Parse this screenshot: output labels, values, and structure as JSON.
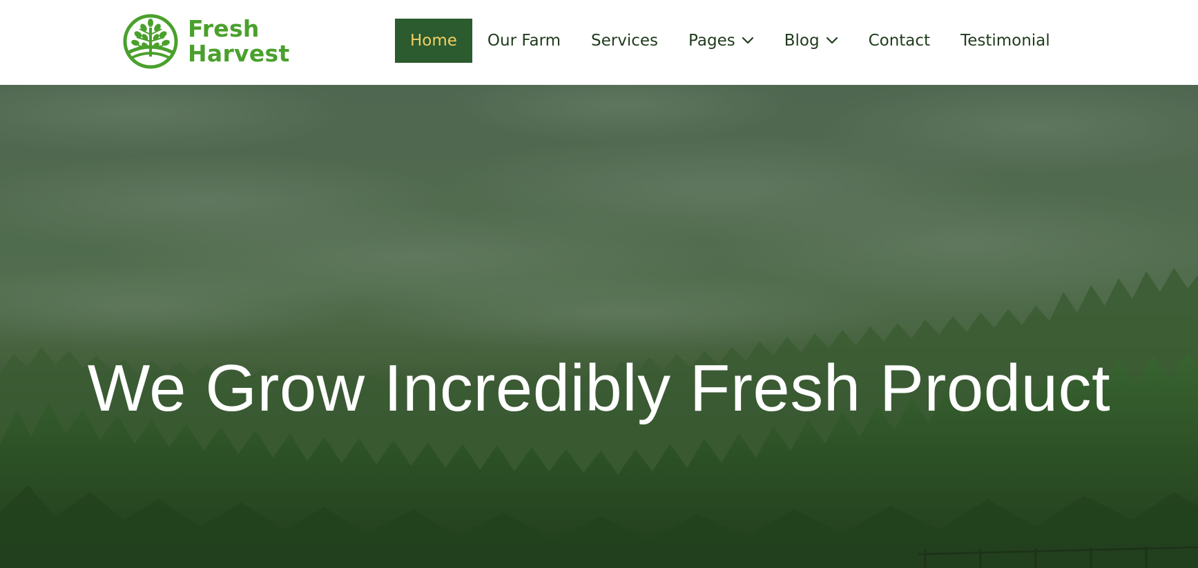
{
  "brand": {
    "line1": "Fresh",
    "line2": "Harvest",
    "logo_icon": "tree-in-circle-icon",
    "color": "#4aa02c"
  },
  "nav": {
    "items": [
      {
        "label": "Home",
        "active": true
      },
      {
        "label": "Our Farm"
      },
      {
        "label": "Services"
      },
      {
        "label": "Pages",
        "dropdown": true
      },
      {
        "label": "Blog",
        "dropdown": true
      },
      {
        "label": "Contact"
      },
      {
        "label": "Testimonial"
      }
    ],
    "active_bg": "#2b5b2e",
    "active_text": "#f3cf63",
    "text_color": "#1f3b1c"
  },
  "hero": {
    "title": "We Grow Incredibly Fresh Product",
    "background": "cloudy-sky-over-pine-forest-image"
  }
}
